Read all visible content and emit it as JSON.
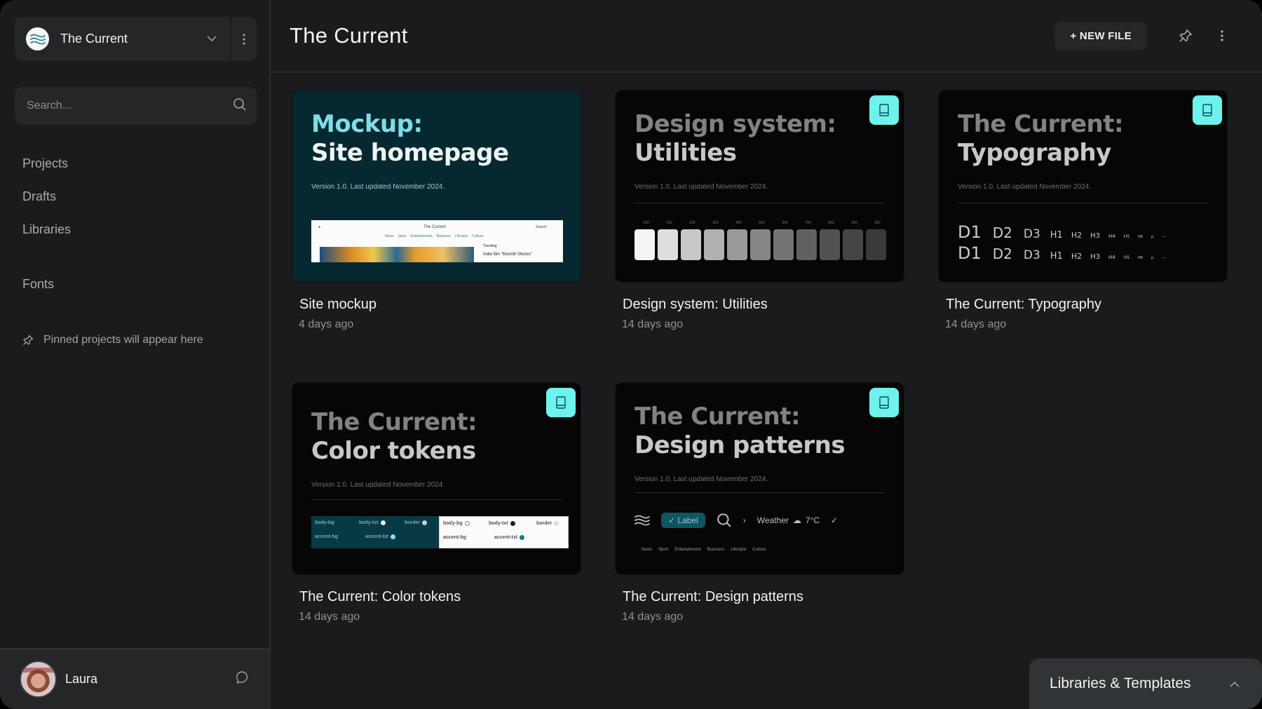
{
  "sidebar": {
    "project": {
      "name": "The Current",
      "logo_icon": "waves-icon",
      "chevron_icon": "chevron-down-icon",
      "more_icon": "more-vertical-icon"
    },
    "search": {
      "placeholder": "Search...",
      "value": "",
      "icon": "search-icon"
    },
    "nav": [
      {
        "label": "Projects"
      },
      {
        "label": "Drafts"
      },
      {
        "label": "Libraries"
      },
      {
        "label": "Fonts"
      }
    ],
    "pinned_note": {
      "icon": "pin-icon",
      "text": "Pinned projects will appear here"
    },
    "user": {
      "name": "Laura",
      "chat_icon": "comment-icon"
    }
  },
  "header": {
    "title": "The Current",
    "new_file_label": "+ NEW FILE",
    "pin_icon": "pin-icon",
    "more_icon": "more-vertical-icon"
  },
  "files": [
    {
      "title": "Site mockup",
      "updated": "4 days ago",
      "shared_library": false,
      "thumbnail": {
        "heading_line1": "Mockup:",
        "heading_line2": "Site homepage",
        "subtitle": "Version 1.0. Last updated November 2024.",
        "preview_site_title": "The Current",
        "preview_search": "Search",
        "preview_nav": [
          "News",
          "Sport",
          "Entertainment",
          "Business",
          "Lifestyle",
          "Culture"
        ],
        "preview_trending": "Trending",
        "preview_headline": "Indie film \"Moonlit Shores\""
      }
    },
    {
      "title": "Design system: Utilities",
      "updated": "14 days ago",
      "shared_library": true,
      "thumbnail": {
        "heading_line1": "Design system:",
        "heading_line2": "Utilities",
        "subtitle": "Version 1.0. Last updated November 2024.",
        "scale_labels": [
          "050",
          "100",
          "200",
          "300",
          "400",
          "500",
          "600",
          "700",
          "800",
          "900",
          "950"
        ],
        "scale_colors": [
          "#f4f4f4",
          "#dedede",
          "#c8c8c8",
          "#b0b0b0",
          "#9a9a9a",
          "#868686",
          "#747474",
          "#616161",
          "#525252",
          "#444444",
          "#393939"
        ]
      }
    },
    {
      "title": "The Current: Typography",
      "updated": "14 days ago",
      "shared_library": true,
      "thumbnail": {
        "heading_line1": "The Current:",
        "heading_line2": "Typography",
        "subtitle": "Version 1.0. Last updated November 2024.",
        "styles": [
          "D1",
          "D2",
          "D3",
          "H1",
          "H2",
          "H3",
          "H4",
          "H5",
          "H6",
          "p",
          "—"
        ]
      }
    },
    {
      "title": "The Current: Color tokens",
      "updated": "14 days ago",
      "shared_library": true,
      "thumbnail": {
        "heading_line1": "The Current:",
        "heading_line2": "Color tokens",
        "subtitle": "Version 1.0. Last updated November 2024.",
        "tokens": [
          "body-bg",
          "body-txt",
          "border",
          "accent-bg",
          "accent-txt"
        ]
      }
    },
    {
      "title": "The Current: Design patterns",
      "updated": "14 days ago",
      "shared_library": true,
      "thumbnail": {
        "heading_line1": "The Current:",
        "heading_line2": "Design patterns",
        "subtitle": "Version 1.0. Last updated November 2024.",
        "chip_label": "✓ Label",
        "weather_label": "Weather",
        "temperature": "7°C",
        "nav": [
          "News",
          "Sport",
          "Entertainment",
          "Business",
          "Lifestyle",
          "Culture"
        ]
      }
    }
  ],
  "library_badge_icon": "book-icon",
  "libraries_panel": {
    "label": "Libraries & Templates",
    "chevron_icon": "chevron-up-icon"
  },
  "colors": {
    "accent": "#6ef2ee",
    "background": "#1b1b1d",
    "surface": "#242628",
    "mockup_bg": "#062830"
  }
}
